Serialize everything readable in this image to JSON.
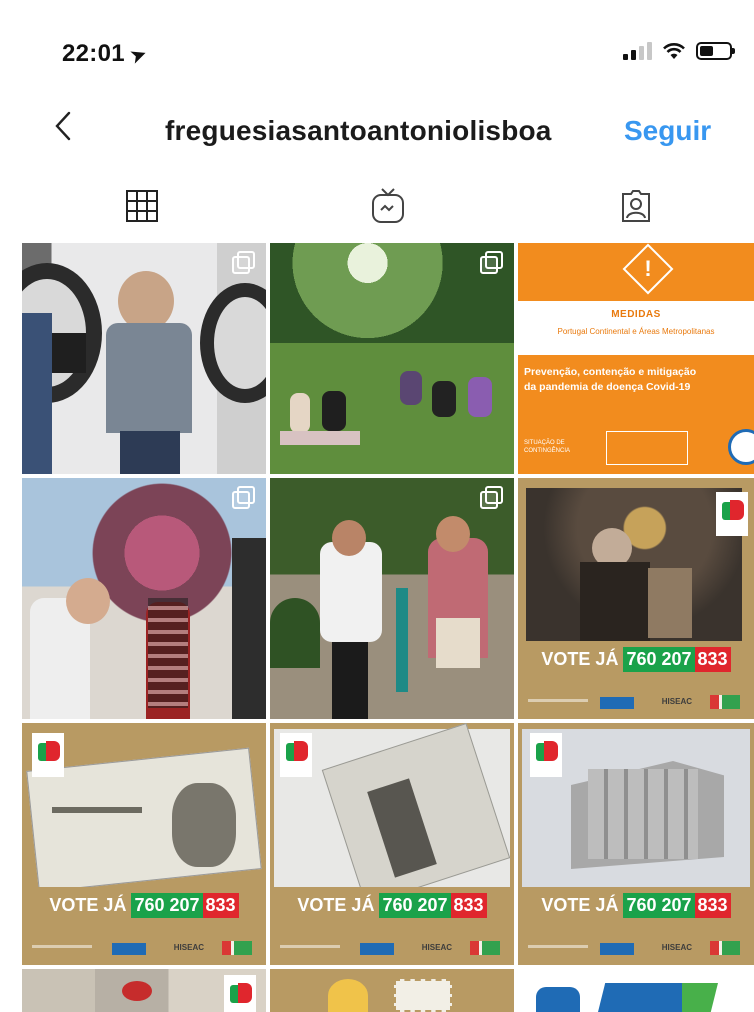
{
  "status": {
    "time": "22:01"
  },
  "header": {
    "username": "freguesiasantoantoniolisboa",
    "follow_label": "Seguir"
  },
  "tabs": [
    {
      "name": "grid",
      "icon": "grid-icon"
    },
    {
      "name": "igtv",
      "icon": "igtv-icon"
    },
    {
      "name": "tagged",
      "icon": "tagged-person-icon"
    }
  ],
  "posts": {
    "medidas": {
      "title": "MEDIDAS",
      "subtitle": "Portugal Continental e Áreas Metropolitanas",
      "text_line1": "Prevenção, contenção e mitigação",
      "text_line2": "da pandemia de doença Covid-19",
      "small": "SITUAÇÃO DE CONTINGÊNCIA"
    },
    "vote": {
      "prefix": "VOTE JÁ",
      "num_a": "760 207",
      "num_b": "833",
      "sponsor": "HISEAC"
    }
  },
  "colors": {
    "accent": "#3897f0",
    "vote_panel": "#b89a63",
    "green": "#1aa24a",
    "red": "#e0262d",
    "orange": "#f28c1e"
  }
}
